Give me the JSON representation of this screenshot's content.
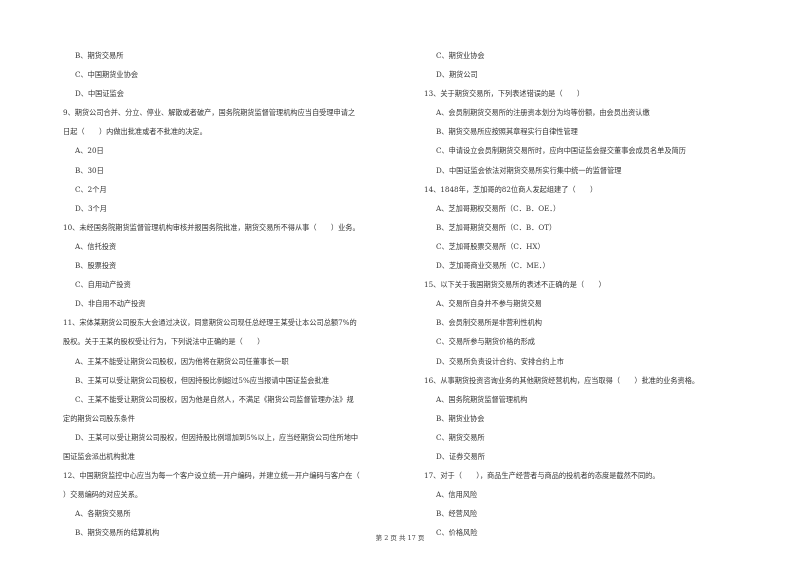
{
  "left_column": [
    {
      "type": "opt",
      "text": "B、期货交易所"
    },
    {
      "type": "opt",
      "text": "C、中国期货业协会"
    },
    {
      "type": "opt",
      "text": "D、中国证监会"
    },
    {
      "type": "q",
      "text": "9、期货公司合并、分立、停业、解散或者破产，国务院期货监督管理机构应当自受理申请之"
    },
    {
      "type": "q",
      "text": "日起（　　）内做出批准或者不批准的决定。"
    },
    {
      "type": "opt",
      "text": "A、20日"
    },
    {
      "type": "opt",
      "text": "B、30日"
    },
    {
      "type": "opt",
      "text": "C、2个月"
    },
    {
      "type": "opt",
      "text": "D、3个月"
    },
    {
      "type": "q",
      "text": "10、未经国务院期货监督管理机构审核并报国务院批准，期货交易所不得从事（　　）业务。"
    },
    {
      "type": "opt",
      "text": "A、信托投资"
    },
    {
      "type": "opt",
      "text": "B、股票投资"
    },
    {
      "type": "opt",
      "text": "C、自用动产投资"
    },
    {
      "type": "opt",
      "text": "D、非自用不动产投资"
    },
    {
      "type": "q",
      "text": "11、宋体某期货公司股东大会通过决议，同意期货公司现任总经理王某受让本公司总额7%的"
    },
    {
      "type": "q",
      "text": "股权。关于王某的股权受让行为，下列说法中正确的是（　　）"
    },
    {
      "type": "opt",
      "text": "A、王某不能受让期货公司股权，因为他将在期货公司任董事长一职"
    },
    {
      "type": "opt",
      "text": "B、王某可以受让期货公司股权，但因持股比例超过5%应当报请中国证监会批准"
    },
    {
      "type": "opt",
      "text": "C、王某不能受让期货公司股权，因为他是自然人，不满足《期货公司监督管理办法》规"
    },
    {
      "type": "q",
      "text": "定的期货公司股东条件"
    },
    {
      "type": "opt",
      "text": "D、王某可以受让期货公司股权，但因持股比例增加到5%以上，应当经期货公司住所地中"
    },
    {
      "type": "q",
      "text": "国证监会派出机构批准"
    },
    {
      "type": "q",
      "text": "12、中国期货监控中心应当为每一个客户设立统一开户编码，并建立统一开户编码与客户在（"
    },
    {
      "type": "q",
      "text": "）交易编码的对应关系。"
    },
    {
      "type": "opt",
      "text": "A、各期货交易所"
    },
    {
      "type": "opt",
      "text": "B、期货交易所的结算机构"
    }
  ],
  "right_column": [
    {
      "type": "opt",
      "text": "C、期货业协会"
    },
    {
      "type": "opt",
      "text": "D、期货公司"
    },
    {
      "type": "q",
      "text": "13、关于期货交易所，下列表述错误的是（　　）"
    },
    {
      "type": "opt",
      "text": "A、会员制期货交易所的注册资本划分为均等份额，由会员出资认缴"
    },
    {
      "type": "opt",
      "text": "B、期货交易所应按照其章程实行自律性管理"
    },
    {
      "type": "opt",
      "text": "C、申请设立会员制期货交易所时，应向中国证监会提交董事会成员名单及简历"
    },
    {
      "type": "opt",
      "text": "D、中国证监会依法对期货交易所实行集中统一的监督管理"
    },
    {
      "type": "q",
      "text": "14、1848年，芝加哥的82位商人发起组建了（　　）"
    },
    {
      "type": "opt",
      "text": "A、芝加哥期权交易所（C．B．OE．）"
    },
    {
      "type": "opt",
      "text": "B、芝加哥期货交易所（C．B．OT）"
    },
    {
      "type": "opt",
      "text": "C、芝加哥股票交易所（C．HX）"
    },
    {
      "type": "opt",
      "text": "D、芝加哥商业交易所（C．ME．）"
    },
    {
      "type": "q",
      "text": "15、以下关于我国期货交易所的表述不正确的是（　　）"
    },
    {
      "type": "opt",
      "text": "A、交易所自身并不参与期货交易"
    },
    {
      "type": "opt",
      "text": "B、会员制交易所是非营利性机构"
    },
    {
      "type": "opt",
      "text": "C、交易所参与期货价格的形成"
    },
    {
      "type": "opt",
      "text": "D、交易所负责设计合约、安排合约上市"
    },
    {
      "type": "q",
      "text": "16、从事期货投资咨询业务的其他期货经营机构，应当取得（　　）批准的业务资格。"
    },
    {
      "type": "opt",
      "text": "A、国务院期货监督管理机构"
    },
    {
      "type": "opt",
      "text": "B、期货业协会"
    },
    {
      "type": "opt",
      "text": "C、期货交易所"
    },
    {
      "type": "opt",
      "text": "D、证券交易所"
    },
    {
      "type": "q",
      "text": "17、对于（　　），商品生产经营者与商品的投机者的态度是截然不同的。"
    },
    {
      "type": "opt",
      "text": "A、信用风险"
    },
    {
      "type": "opt",
      "text": "B、经营风险"
    },
    {
      "type": "opt",
      "text": "C、价格风险"
    }
  ],
  "footer": {
    "page_label": "第 2 页 共 17 页"
  }
}
